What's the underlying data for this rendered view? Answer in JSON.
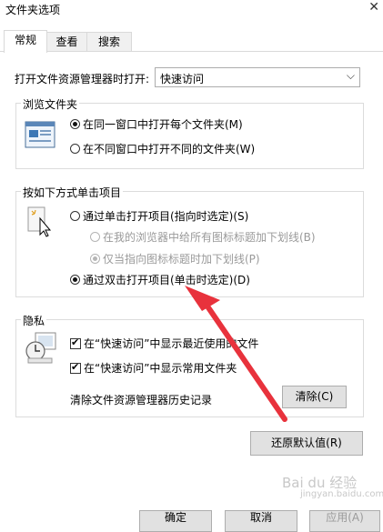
{
  "window": {
    "title": "文件夹选项",
    "close_icon": "close-icon"
  },
  "tabs": [
    {
      "label": "常规"
    },
    {
      "label": "查看"
    },
    {
      "label": "搜索"
    }
  ],
  "open_explorer": {
    "label": "打开文件资源管理器时打开:",
    "value": "快速访问"
  },
  "browse": {
    "title": "浏览文件夹",
    "option_same": "在同一窗口中打开每个文件夹(M)",
    "option_new": "在不同窗口中打开不同的文件夹(W)"
  },
  "click_items": {
    "title": "按如下方式单击项目",
    "option_single": "通过单击打开项目(指向时选定)(S)",
    "sub_browser": "在我的浏览器中给所有图标标题加下划线(B)",
    "sub_point": "仅当指向图标标题时加下划线(P)",
    "option_double": "通过双击打开项目(单击时选定)(D)"
  },
  "privacy": {
    "title": "隐私",
    "recent_files": "在“快速访问”中显示最近使用的文件",
    "frequent_folders": "在“快速访问”中显示常用文件夹",
    "clear_label": "清除文件资源管理器历史记录",
    "clear_button": "清除(C)"
  },
  "restore_button": "还原默认值(R)",
  "footer": {
    "ok": "确定",
    "cancel": "取消",
    "apply": "应用(A)"
  },
  "watermark": {
    "text": "Bai du 经验",
    "sub": "jingyan.baidu.com"
  },
  "colors": {
    "arrow": "#e8323c",
    "accent": "#0078d7"
  }
}
